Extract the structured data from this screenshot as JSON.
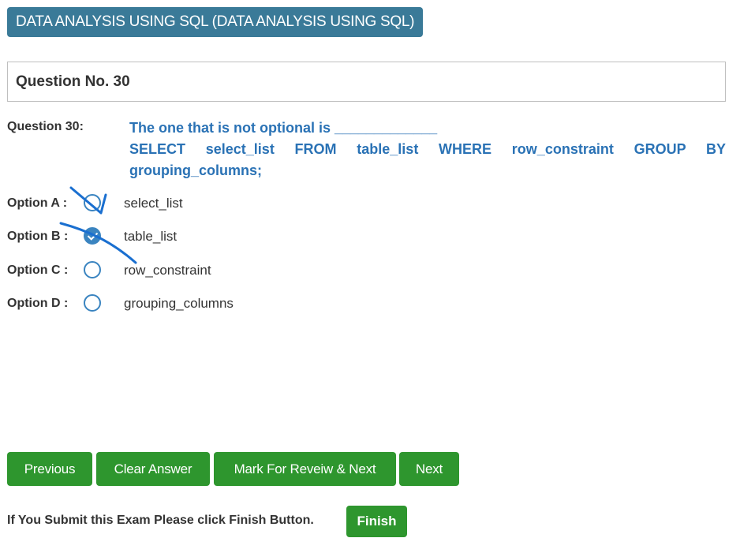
{
  "subject": {
    "title": "DATA ANALYSIS USING SQL (DATA ANALYSIS USING SQL)"
  },
  "question": {
    "header": "Question No. 30",
    "label": "Question 30:",
    "line1": "The one that is not optional is _____________",
    "line2": "SELECT select_list FROM table_list WHERE row_constraint GROUP BY",
    "line3": "grouping_columns;"
  },
  "options": [
    {
      "label": "Option A :",
      "text": "select_list",
      "selected": false
    },
    {
      "label": "Option B :",
      "text": "table_list",
      "selected": true
    },
    {
      "label": "Option C :",
      "text": "row_constraint",
      "selected": false
    },
    {
      "label": "Option D :",
      "text": "grouping_columns",
      "selected": false
    }
  ],
  "buttons": {
    "previous": "Previous",
    "clear": "Clear Answer",
    "review": "Mark For Reveiw & Next",
    "next": "Next",
    "finish": "Finish"
  },
  "footer": {
    "finish_text": "If You Submit this Exam Please click Finish Button."
  },
  "colors": {
    "accent": "#3a7a98",
    "question_text": "#2a72b5",
    "radio": "#3a84c0",
    "button": "#2e962e",
    "annotation_ink": "#1a6fd0"
  }
}
